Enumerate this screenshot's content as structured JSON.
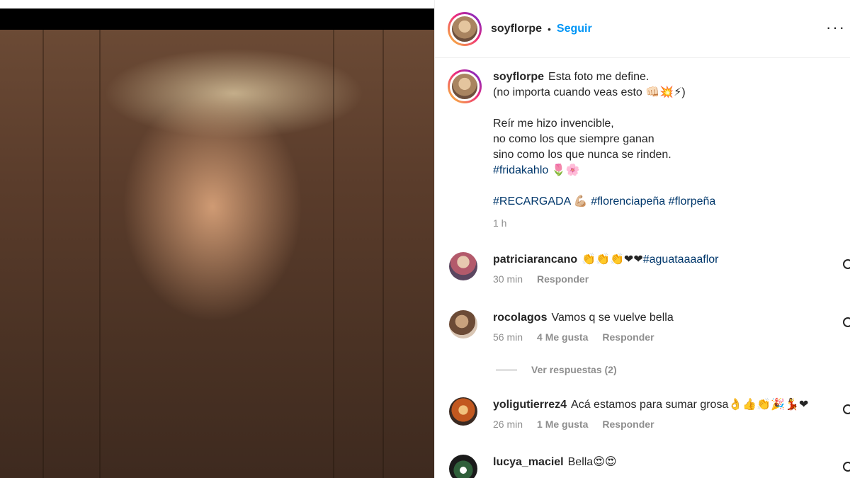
{
  "post": {
    "username": "soyflorpe",
    "separator": "•",
    "follow_label": "Seguir",
    "more_label": "···"
  },
  "caption": {
    "username": "soyflorpe",
    "line1": "Esta foto me define.",
    "line2": "(no importa cuando veas esto 👊🏻💥⚡)",
    "line3": "Reír me hizo invencible,",
    "line4": "no como los que siempre ganan",
    "line5": "sino como los que nunca se rinden.",
    "hashtag1": "#fridakahlo",
    "hashtag1_emoji": " 🌷🌸",
    "hashtag2": "#RECARGADA",
    "hashtag2_emoji": " 💪🏼 ",
    "hashtag3": "#florenciapeña",
    "hashtag4": "#florpeña",
    "time": "1 h"
  },
  "comments": [
    {
      "username": "patriciarancano",
      "text": "👏👏👏❤❤",
      "hashtag": "#aguataaaaflor",
      "time": "30 min",
      "likes": "",
      "reply_label": "Responder"
    },
    {
      "username": "rocolagos",
      "text": "Vamos q se vuelve bella",
      "hashtag": "",
      "time": "56 min",
      "likes": "4 Me gusta",
      "reply_label": "Responder"
    },
    {
      "username": "yoligutierrez4",
      "text": "Acá estamos para sumar grosa👌👍👏🎉💃❤",
      "hashtag": "",
      "time": "26 min",
      "likes": "1 Me gusta",
      "reply_label": "Responder"
    },
    {
      "username": "lucya_maciel",
      "text": "Bella😍😍",
      "hashtag": "",
      "time": "",
      "likes": "",
      "reply_label": ""
    }
  ],
  "view_replies_label": "Ver respuestas (2)",
  "colors": {
    "accent": "#0095f6",
    "hashtag": "#00376b",
    "muted": "#8e8e8e",
    "text": "#262626"
  },
  "icons": {
    "more": "more-horizontal-icon",
    "like": "heart-outline-icon"
  }
}
